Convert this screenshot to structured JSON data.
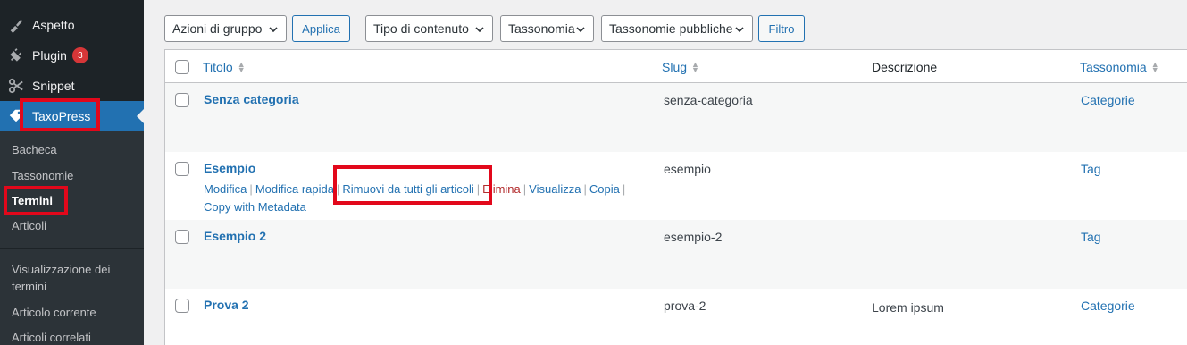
{
  "sidebar": {
    "menu": [
      {
        "label": "Aspetto",
        "icon": "paintbrush-icon"
      },
      {
        "label": "Plugin",
        "icon": "plugin-icon",
        "badge": "3"
      },
      {
        "label": "Snippet",
        "icon": "scissors-icon"
      },
      {
        "label": "TaxoPress",
        "icon": "tag-icon",
        "current": true
      }
    ],
    "submenu": [
      {
        "label": "Bacheca"
      },
      {
        "label": "Tassonomie"
      },
      {
        "label": "Termini",
        "current": true
      },
      {
        "label": "Articoli"
      },
      {
        "label": "Visualizzazione dei termini"
      },
      {
        "label": "Articolo corrente"
      },
      {
        "label": "Articoli correlati"
      }
    ]
  },
  "toolbar": {
    "bulk_actions": "Azioni di gruppo",
    "apply": "Applica",
    "content_type": "Tipo di contenuto",
    "taxonomy": "Tassonomia",
    "public_taxonomies": "Tassonomie pubbliche",
    "filter": "Filtro"
  },
  "table": {
    "columns": {
      "title": "Titolo",
      "slug": "Slug",
      "description": "Descrizione",
      "taxonomy": "Tassonomia"
    },
    "rows": [
      {
        "title": "Senza categoria",
        "slug": "senza-categoria",
        "description": "",
        "taxonomy": "Categorie"
      },
      {
        "title": "Esempio",
        "slug": "esempio",
        "description": "",
        "taxonomy": "Tag",
        "actions": [
          "Modifica",
          "Modifica rapida",
          "Rimuovi da tutti gli articoli",
          "Elimina",
          "Visualizza",
          "Copia",
          "Copy with Metadata"
        ]
      },
      {
        "title": "Esempio 2",
        "slug": "esempio-2",
        "description": "",
        "taxonomy": "Tag"
      },
      {
        "title": "Prova 2",
        "slug": "prova-2",
        "description": "Lorem ipsum",
        "taxonomy": "Categorie"
      }
    ]
  },
  "colors": {
    "accent": "#2271b1",
    "sidebar": "#1d2327",
    "highlight": "#e2081b",
    "delete": "#b32d2e"
  }
}
